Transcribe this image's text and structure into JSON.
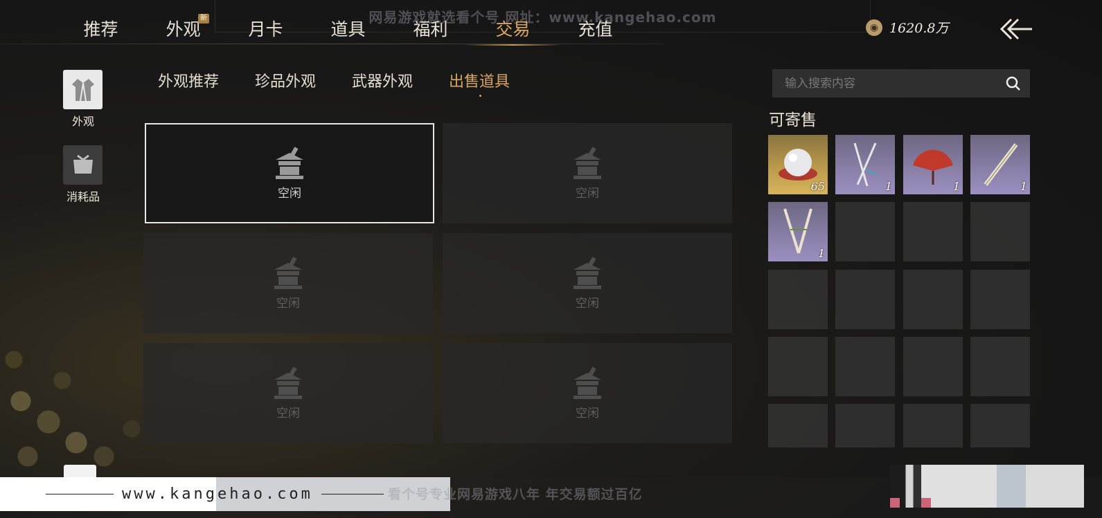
{
  "watermark": {
    "top_text": "网易游戏就选看个号   网址：www.kangehao.com",
    "site": "www.kangehao.com",
    "slogan": "看个号专业网易游戏八年   年交易额过百亿"
  },
  "top_nav": {
    "tabs": [
      {
        "label": "推荐"
      },
      {
        "label": "外观",
        "badge": "新"
      },
      {
        "label": "月卡"
      },
      {
        "label": "道具"
      },
      {
        "label": "福利"
      },
      {
        "label": "交易",
        "active": true
      },
      {
        "label": "充值"
      }
    ]
  },
  "currency": {
    "icon": "coin-pouch-icon",
    "amount": "1620.8万"
  },
  "side_categories": [
    {
      "label": "外观",
      "icon": "robe-icon",
      "active": true
    },
    {
      "label": "消耗品",
      "icon": "bundle-icon"
    }
  ],
  "sub_tabs": [
    {
      "label": "外观推荐"
    },
    {
      "label": "珍品外观"
    },
    {
      "label": "武器外观"
    },
    {
      "label": "出售道具",
      "active": true
    }
  ],
  "slots": [
    {
      "label": "空闲",
      "selected": true
    },
    {
      "label": "空闲"
    },
    {
      "label": "空闲"
    },
    {
      "label": "空闲"
    },
    {
      "label": "空闲"
    },
    {
      "label": "空闲"
    }
  ],
  "search": {
    "placeholder": "输入搜索内容"
  },
  "consignable": {
    "title": "可寄售",
    "items": [
      {
        "icon": "pearl-icon",
        "count": "65",
        "rarity": "gold"
      },
      {
        "icon": "crossed-sticks-icon",
        "count": "1",
        "rarity": "purple"
      },
      {
        "icon": "red-fan-icon",
        "count": "1",
        "rarity": "purple"
      },
      {
        "icon": "flute-icon",
        "count": "1",
        "rarity": "purple"
      },
      {
        "icon": "twin-blades-icon",
        "count": "1",
        "rarity": "purple"
      }
    ],
    "empty_cells": 15
  },
  "colors": {
    "accent": "#d9a560",
    "text": "#e6e1d6"
  }
}
